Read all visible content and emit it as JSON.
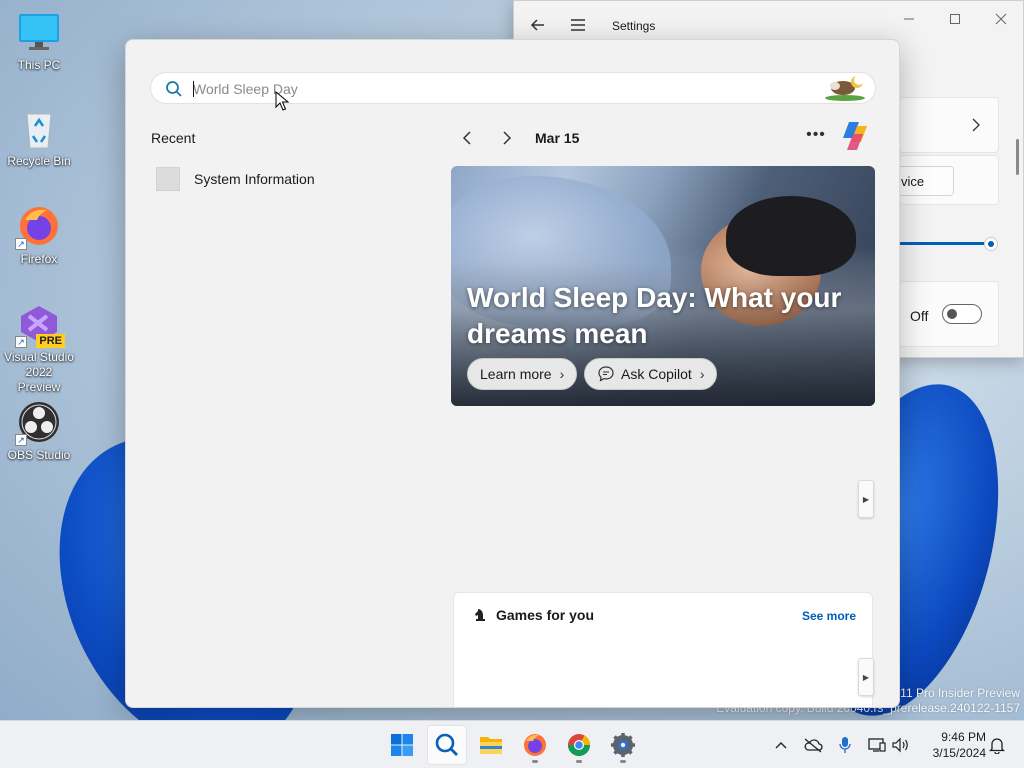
{
  "desktop": {
    "icons": [
      {
        "label": "This PC"
      },
      {
        "label": "Recycle Bin"
      },
      {
        "label": "Firefox"
      },
      {
        "label": "Visual Studio 2022 Preview",
        "badge": "PRE"
      },
      {
        "label": "OBS Studio"
      }
    ],
    "watermark": {
      "line1": "11 Pro Insider Preview",
      "line2": "Evaluation copy. Build 26040.rs_prerelease.240122-1157"
    }
  },
  "settings_window": {
    "title": "Settings",
    "device_button": "vice",
    "toggle_state": "Off",
    "slider_level": 1.0
  },
  "search_panel": {
    "search": {
      "placeholder": "World Sleep Day",
      "value": ""
    },
    "recent": {
      "heading": "Recent",
      "items": [
        {
          "label": "System Information"
        }
      ]
    },
    "date": "Mar 15",
    "hero": {
      "title": "World Sleep Day: What your dreams mean",
      "learn_more": "Learn more",
      "ask_copilot": "Ask Copilot"
    },
    "games": {
      "heading": "Games for you",
      "see_more": "See more"
    }
  },
  "taskbar": {
    "apps": [
      "start-icon",
      "search-icon",
      "file-explorer-icon",
      "firefox-icon",
      "chrome-icon",
      "settings-icon"
    ],
    "clock": {
      "time": "9:46 PM",
      "date": "3/15/2024"
    }
  },
  "colors": {
    "accent": "#005fb8",
    "panel": "#f2f2f2"
  }
}
